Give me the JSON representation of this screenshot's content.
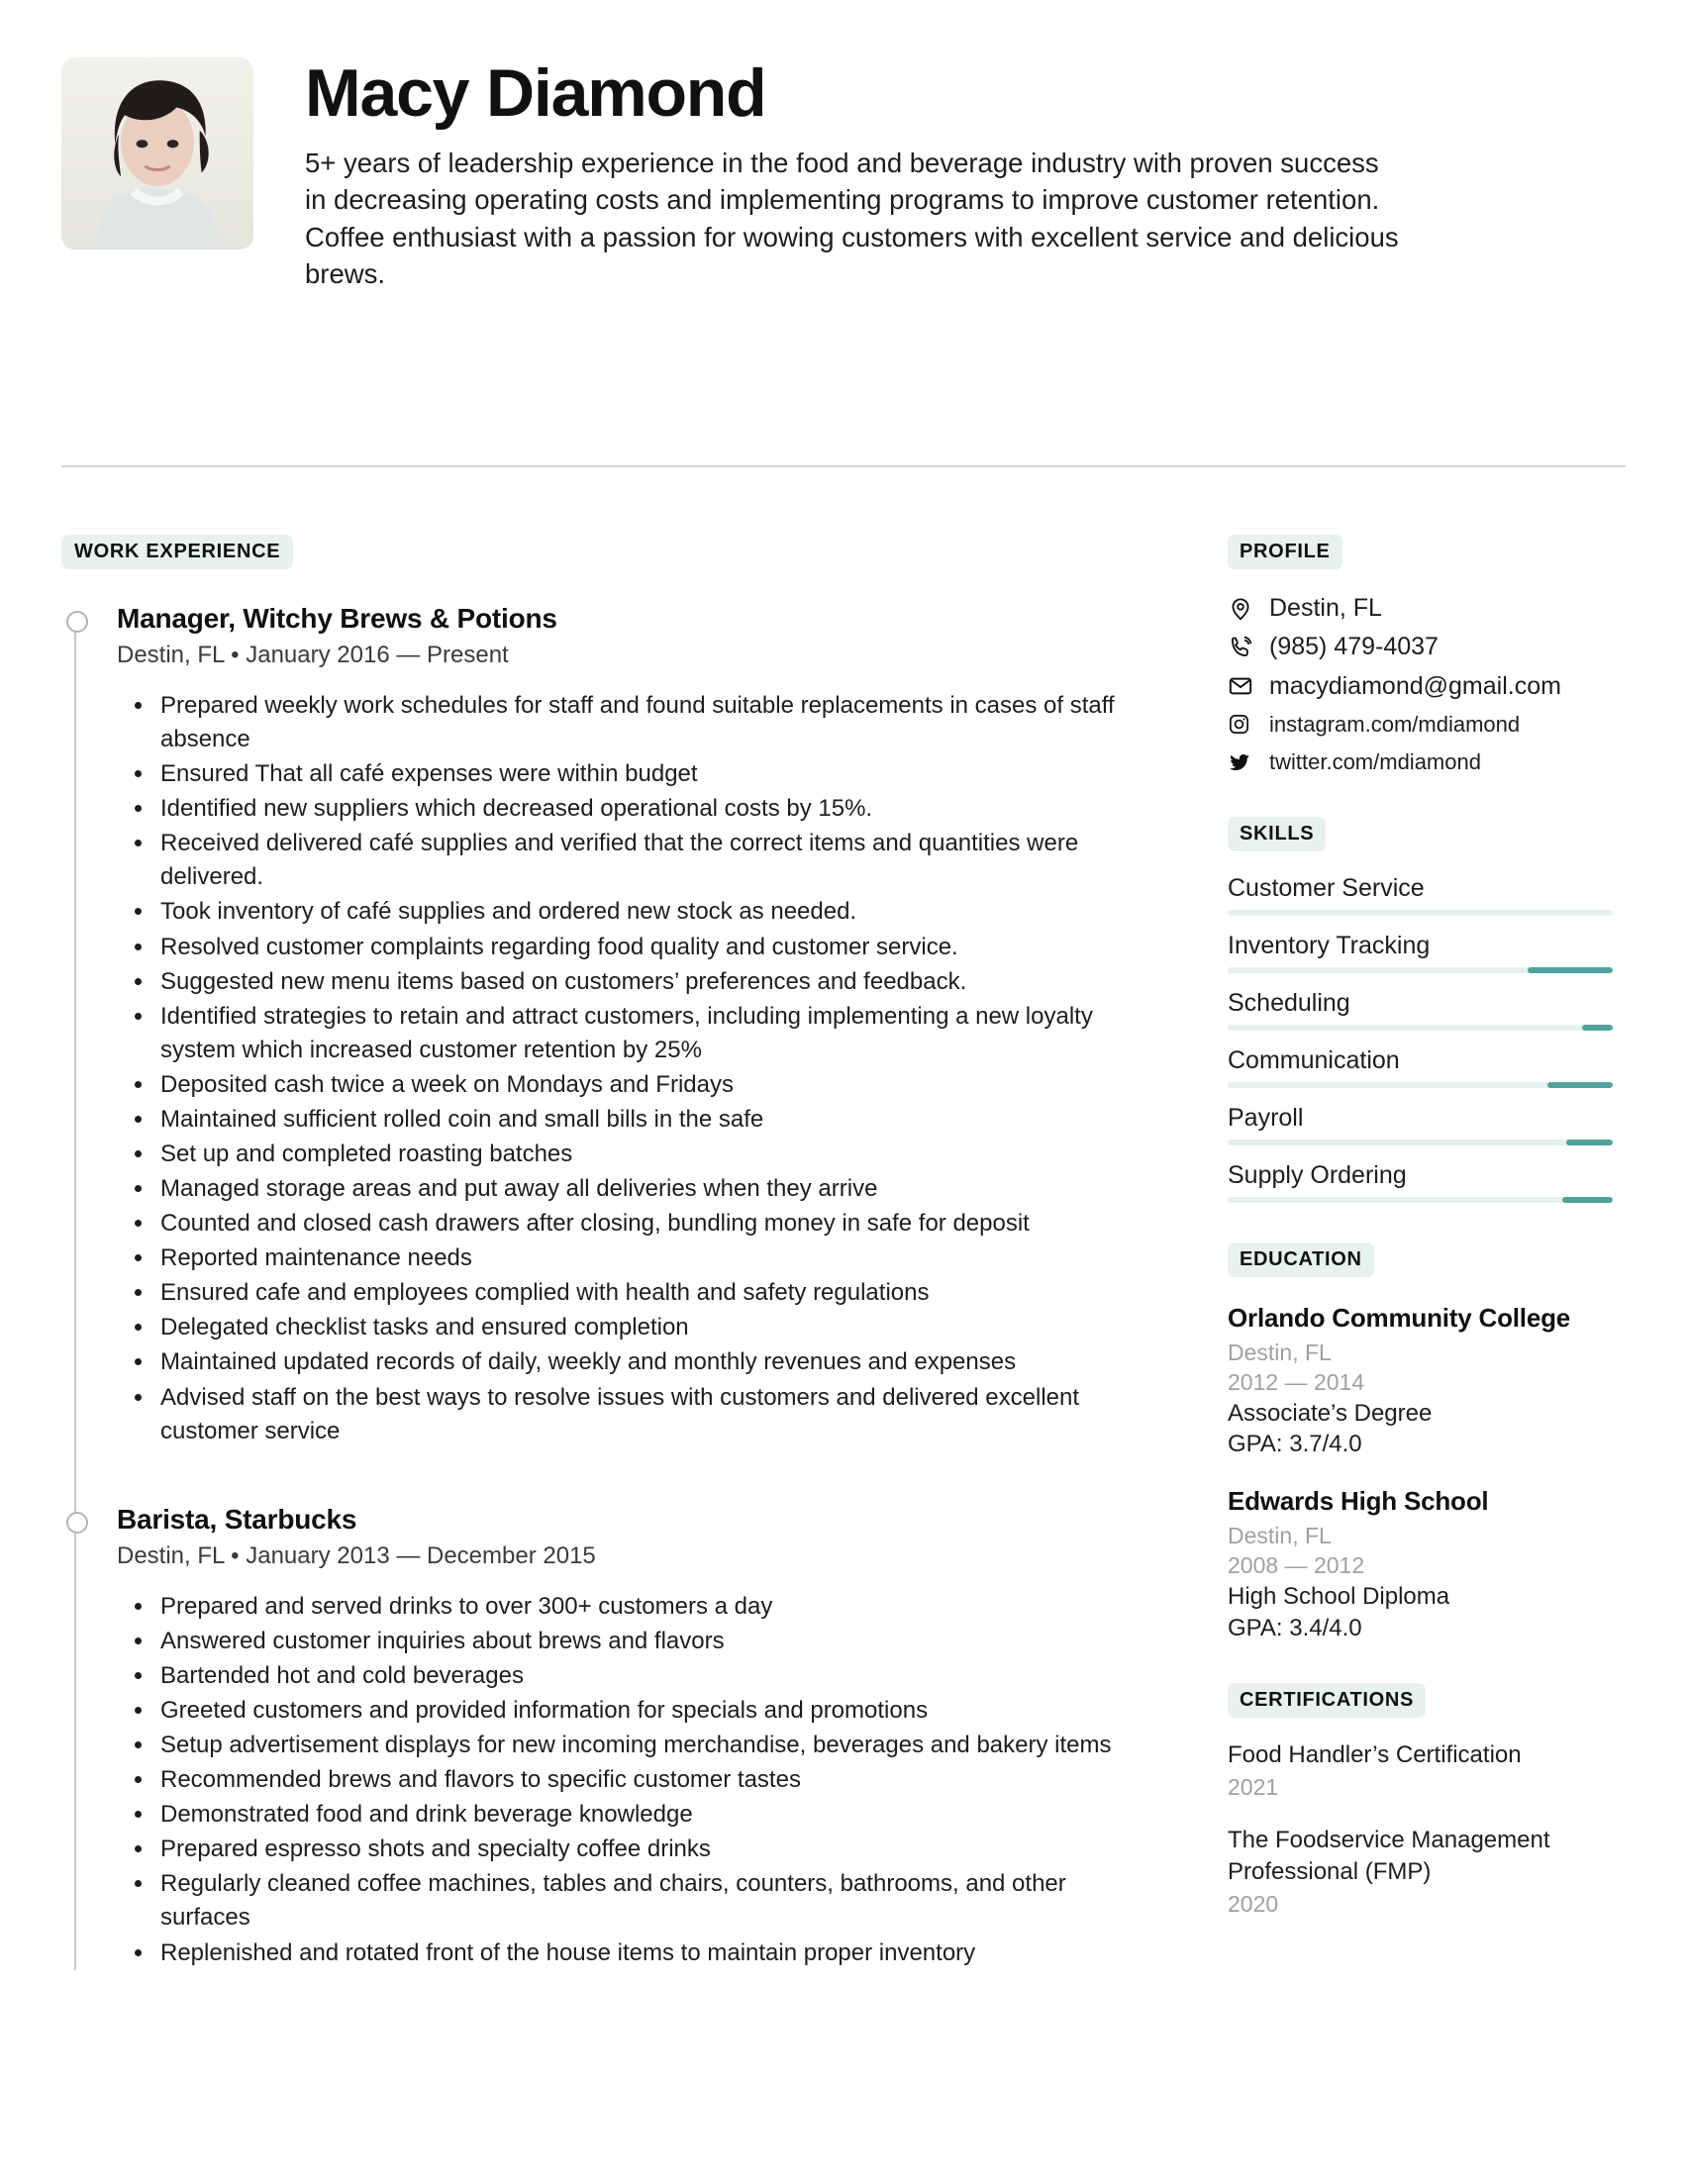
{
  "colors": {
    "chip_bg": "#e7f2f0",
    "skill_track": "#e4f1ee",
    "skill_fill": "#4fa39b",
    "muted_text": "#a0a0a0",
    "rule": "#d4d4d4"
  },
  "header": {
    "name": "Macy Diamond",
    "summary": "5+ years of leadership experience in the food and beverage industry with proven success in decreasing operating costs and implementing programs to improve customer retention. Coffee enthusiast with a passion for wowing customers with excellent service and delicious brews.",
    "avatar_icon": "profile-photo"
  },
  "work": {
    "section_label": "WORK EXPERIENCE",
    "jobs": [
      {
        "title": "Manager, Witchy Brews & Potions",
        "meta": "Destin, FL • January 2016 — Present",
        "bullets": [
          "Prepared weekly work schedules for staff and found suitable replacements in cases of staff absence",
          "Ensured That all café expenses were within budget",
          "Identified new suppliers which decreased operational costs by 15%.",
          "Received delivered café supplies and verified that the correct items and quantities were delivered.",
          "Took inventory of café supplies and ordered new stock as needed.",
          "Resolved customer complaints regarding food quality and customer service.",
          "Suggested new menu items based on customers’ preferences and feedback.",
          "Identified strategies to retain and attract customers, including implementing a new loyalty system which increased customer retention by 25%",
          "Deposited cash twice a week on Mondays and Fridays",
          "Maintained sufficient rolled coin and small bills in the safe",
          "Set up and completed roasting batches",
          "Managed storage areas and put away all deliveries when they arrive",
          "Counted and closed cash drawers after closing, bundling money in safe for deposit",
          "Reported maintenance needs",
          "Ensured cafe and employees complied with health and safety regulations",
          "Delegated checklist tasks and ensured completion",
          "Maintained updated records of daily, weekly and monthly revenues and expenses",
          "Advised staff on the best ways to resolve issues with customers and delivered excellent customer service"
        ]
      },
      {
        "title": "Barista, Starbucks",
        "meta": "Destin, FL • January 2013 — December 2015",
        "bullets": [
          "Prepared and served drinks to over 300+ customers a day",
          "Answered customer inquiries about brews and flavors",
          "Bartended hot and cold beverages",
          "Greeted customers and provided information for specials and promotions",
          "Setup advertisement displays for new incoming merchandise, beverages and bakery items",
          "Recommended brews and flavors to specific customer tastes",
          "Demonstrated food and drink beverage knowledge",
          "Prepared espresso shots and specialty coffee drinks",
          "Regularly cleaned coffee machines, tables and chairs, counters, bathrooms, and other surfaces",
          "Replenished and rotated front of the house items to maintain proper inventory"
        ]
      }
    ]
  },
  "profile": {
    "section_label": "PROFILE",
    "contacts": [
      {
        "icon": "location-pin-icon",
        "text": "Destin, FL",
        "size": "normal"
      },
      {
        "icon": "phone-icon",
        "text": "(985) 479-4037",
        "size": "normal"
      },
      {
        "icon": "envelope-icon",
        "text": "macydiamond@gmail.com",
        "size": "normal"
      },
      {
        "icon": "instagram-icon",
        "text": "instagram.com/mdiamond",
        "size": "small"
      },
      {
        "icon": "twitter-icon",
        "text": "twitter.com/mdiamond",
        "size": "small"
      }
    ]
  },
  "skills": {
    "section_label": "SKILLS",
    "items": [
      {
        "label": "Customer Service",
        "fill_percent": 0
      },
      {
        "label": "Inventory Tracking",
        "fill_percent": 22
      },
      {
        "label": "Scheduling",
        "fill_percent": 8
      },
      {
        "label": "Communication",
        "fill_percent": 17
      },
      {
        "label": "Payroll",
        "fill_percent": 12
      },
      {
        "label": "Supply Ordering",
        "fill_percent": 13
      }
    ]
  },
  "education": {
    "section_label": "EDUCATION",
    "entries": [
      {
        "school": "Orlando Community College",
        "location": "Destin, FL",
        "years": "2012 — 2014",
        "degree": "Associate’s Degree",
        "gpa": "GPA: 3.7/4.0"
      },
      {
        "school": "Edwards High School",
        "location": "Destin, FL",
        "years": "2008 — 2012",
        "degree": "High School Diploma",
        "gpa": "GPA: 3.4/4.0"
      }
    ]
  },
  "certifications": {
    "section_label": "CERTIFICATIONS",
    "entries": [
      {
        "name": "Food Handler’s Certification",
        "year": "2021"
      },
      {
        "name": "The Foodservice Management Professional (FMP)",
        "year": "2020"
      }
    ]
  }
}
